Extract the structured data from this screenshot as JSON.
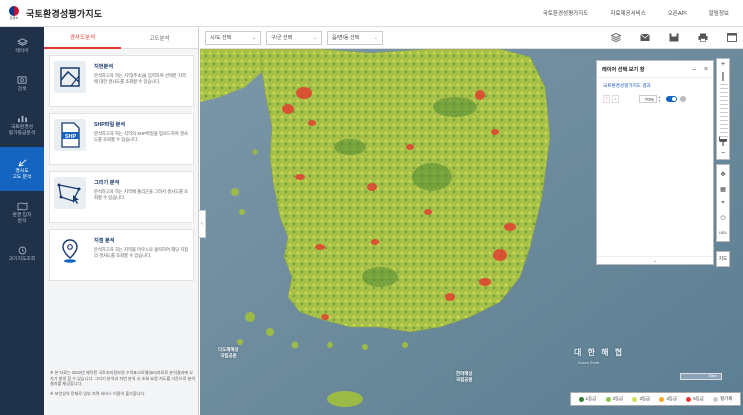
{
  "app": {
    "title": "국토환경성평가지도",
    "emblem_caption": "환경부"
  },
  "topnav": [
    "국토환경성평가지도",
    "자료제공서비스",
    "오픈API",
    "알림정보"
  ],
  "sidebar": {
    "items": [
      {
        "label": "레이어",
        "icon": "layers-icon"
      },
      {
        "label": "검색",
        "icon": "search-icon"
      },
      {
        "label": "국토환경성\n평가등급분석",
        "icon": "bar-chart-icon"
      },
      {
        "label": "경사도\n고도 분석",
        "icon": "slope-icon",
        "active": true
      },
      {
        "label": "환경 입지\n분석",
        "icon": "map-analysis-icon"
      },
      {
        "label": "과거지도조회",
        "icon": "history-icon"
      }
    ]
  },
  "panel": {
    "tabs": [
      {
        "label": "경사도분석",
        "active": true
      },
      {
        "label": "고도분석",
        "active": false
      }
    ],
    "cards": [
      {
        "title": "지번분석",
        "desc": "분석하고자 하는 지역(주소)을 입력하여 선택한 지역에 대한 경사도를 조회할 수 있습니다.",
        "icon": "parcel-icon"
      },
      {
        "title": "SHP파일 분석",
        "desc": "분석하고자 하는 지역의 SHP파일을 업로드하여 경사도를 조회할 수 있습니다.",
        "icon": "shp-file-icon",
        "icon_text": "SHP"
      },
      {
        "title": "그리기 분석",
        "desc": "분석하고자 하는 지역에 폴리곤을 그려서 경사도를 조회할 수 있습니다.",
        "icon": "polygon-draw-icon"
      },
      {
        "title": "지점 분석",
        "desc": "분석하고자 하는 지역을 마우스로 클릭하여 해당 지점의 경사도를 조회할 수 있습니다.",
        "icon": "point-marker-icon"
      }
    ],
    "notes": [
      "※ 본 자료는 2022년 제작된 국토지리정보원 수치표고모델(5m)자료로 분석결과에 오차가 발생 할 수 있습니다. 그리기 분석과 지번 분석 시 조회 요청 지도를 기준으로 분석 결과를 제공합니다.",
      "※ 보안상의 문제로 일부 지역 서비스 이용이 불가합니다."
    ]
  },
  "mapbar": {
    "selects": [
      {
        "value": "시/도 선택"
      },
      {
        "value": "구/군 선택"
      },
      {
        "value": "읍/면/동 선택"
      }
    ],
    "tools": [
      "layers-stack-icon",
      "mail-icon",
      "save-icon",
      "print-icon",
      "window-icon"
    ]
  },
  "layer_panel": {
    "title": "레이어 선택 보기 창",
    "layer_name": "국토환경성평가지도 결과",
    "opacity": "70%",
    "visible": true
  },
  "map": {
    "sea_label": "대 한 해 협",
    "sea_label_en": "Korea Strait",
    "islands": [
      {
        "name": "다도해해상\n국립공원"
      },
      {
        "name": "한려해상\n국립공원"
      }
    ],
    "scale_label": "30km",
    "right_tools": [
      "compass-icon",
      "grid-icon",
      "location-icon",
      "polygon-select-icon"
    ],
    "url_label": "URL",
    "bottom_tool": "지도"
  },
  "legend": {
    "items": [
      {
        "label": "1등급",
        "color": "#2e7d32"
      },
      {
        "label": "2등급",
        "color": "#8bc34a"
      },
      {
        "label": "3등급",
        "color": "#d4e157"
      },
      {
        "label": "4등급",
        "color": "#f9a825"
      },
      {
        "label": "5등급",
        "color": "#e53935"
      },
      {
        "label": "평가제",
        "color": "#c9c9c9"
      }
    ]
  }
}
